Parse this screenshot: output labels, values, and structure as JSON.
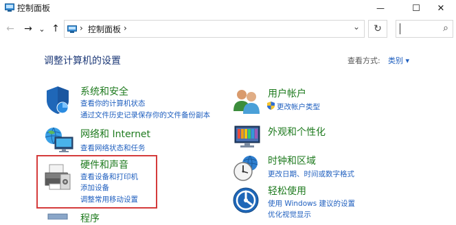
{
  "window": {
    "title": "控制面板",
    "minimize_glyph": "—",
    "maximize_glyph": "☐",
    "close_glyph": "✕"
  },
  "nav": {
    "back_glyph": "←",
    "forward_glyph": "→",
    "recent_glyph": "⌄",
    "up_glyph": "↑"
  },
  "address": {
    "separator": "›",
    "crumb": "控制面板",
    "separator2": "›",
    "dropdown_glyph": "⌄",
    "refresh_glyph": "↻",
    "search_glyph": "⌕"
  },
  "main": {
    "heading": "调整计算机的设置",
    "view_by_label": "查看方式:",
    "view_by_value": "类别 ▾"
  },
  "left_categories": [
    {
      "title": "系统和安全",
      "links": [
        "查看你的计算机状态",
        "通过文件历史记录保存你的文件备份副本"
      ],
      "icon": "shield-icon"
    },
    {
      "title": "网络和 Internet",
      "links": [
        "查看网络状态和任务"
      ],
      "icon": "network-icon"
    },
    {
      "title": "硬件和声音",
      "links": [
        "查看设备和打印机",
        "添加设备",
        "调整常用移动设置"
      ],
      "icon": "printer-icon"
    },
    {
      "title": "程序",
      "links": [],
      "icon": "programs-icon"
    }
  ],
  "right_categories": [
    {
      "title": "用户帐户",
      "links": [
        "更改帐户类型"
      ],
      "icon": "users-icon"
    },
    {
      "title": "外观和个性化",
      "links": [],
      "icon": "appearance-icon"
    },
    {
      "title": "时钟和区域",
      "links": [
        "更改日期、时间或数字格式"
      ],
      "icon": "clock-icon"
    },
    {
      "title": "轻松使用",
      "links": [
        "使用 Windows 建议的设置",
        "优化视觉显示"
      ],
      "icon": "accessibility-icon"
    }
  ],
  "colors": {
    "category_title": "#1e7a1e",
    "link": "#1f5fbf",
    "heading": "#1e3a78",
    "highlight_border": "#d43a3a"
  }
}
